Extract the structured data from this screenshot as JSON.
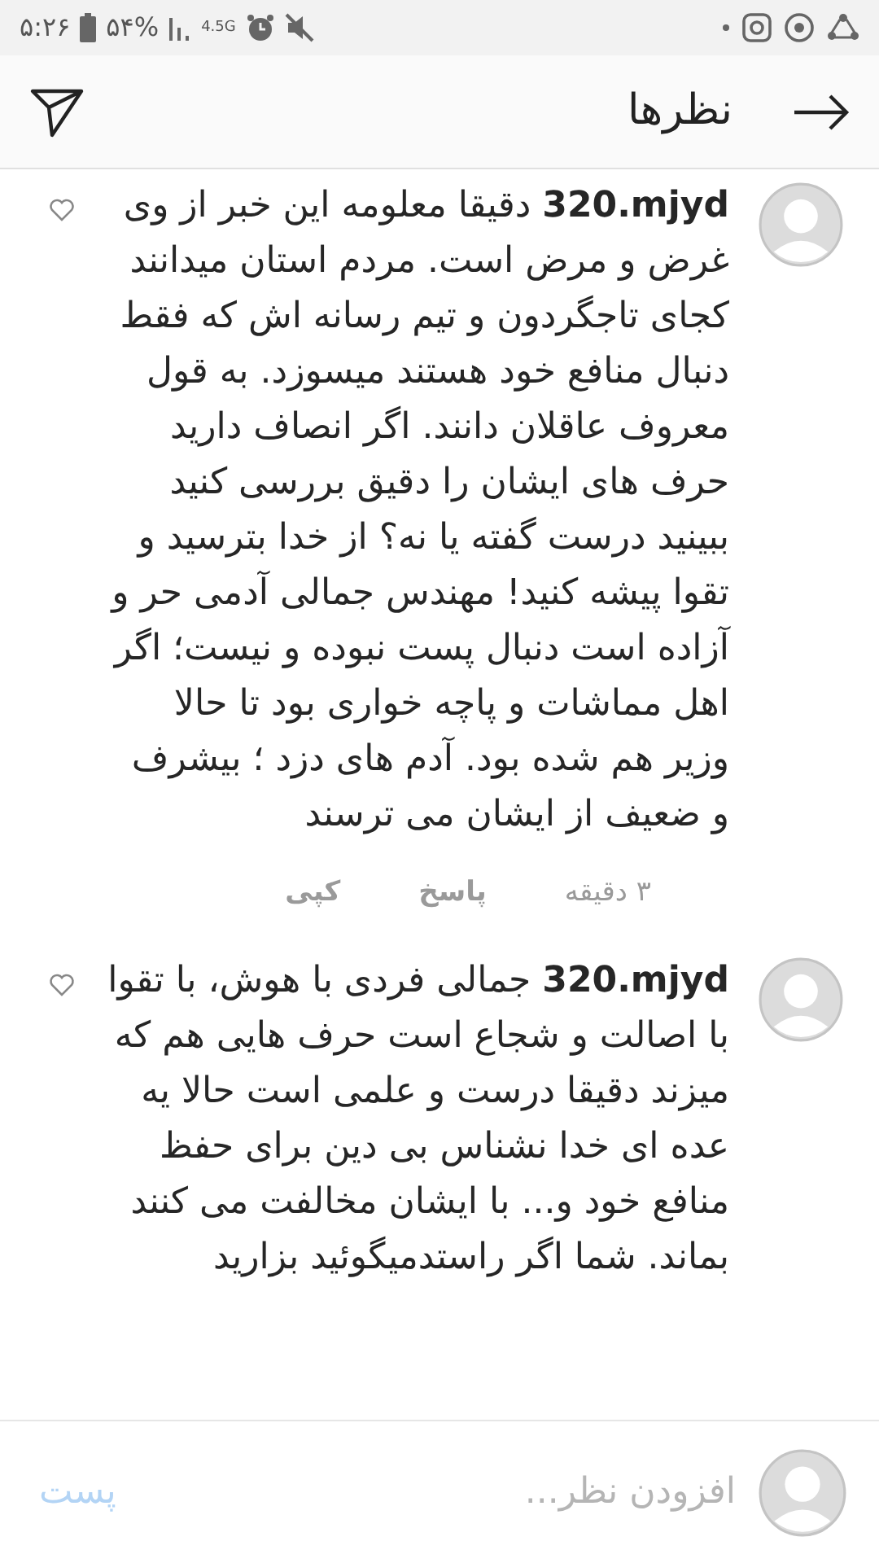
{
  "status_bar": {
    "time": "۵:۲۶",
    "battery": "۵۴%",
    "network": "4.5G"
  },
  "header": {
    "title": "نظرها"
  },
  "comments": [
    {
      "text": "**320.mjyd** دقیقا معلومه این خبر از وی غرض و مرض است. مردم استان میدانند کجای تاجگردون و تیم رسانه اش که فقط دنبال منافع خود هستند میسوزد. به قول معروف عاقلان دانند. اگر انصاف دارید حرف های ایشان را  دقیق بررسی کنید ببینید درست گفته یا نه؟ از خدا بترسید و تقوا پیشه کنید! مهندس جمالی آدمی حر و آزاده است دنبال پست  نبوده و نیست؛ اگر اهل مماشات و پاچه خواری بود تا حالا وزیر هم شده بود. آدم های دزد ؛ بیشرف و ضعیف از ایشان می ترسند",
      "time": "۳ دقیقه",
      "actions": [
        "پاسخ",
        "کپی"
      ]
    },
    {
      "text": "**320.mjyd** جمالی فردی با هوش، با تقوا  با اصالت و شجاع است حرف هایی هم که میزند دقیقا درست و علمی است حالا یه عده ای خدا نشناس بی دین برای حفظ منافع خود و... با ایشان مخالفت می کنند بماند. شما اگر راستدمیگوئید بزارید"
    }
  ],
  "composer": {
    "placeholder": "افزودن نظر...",
    "post_button": "پست",
    "post_enabled": false
  }
}
